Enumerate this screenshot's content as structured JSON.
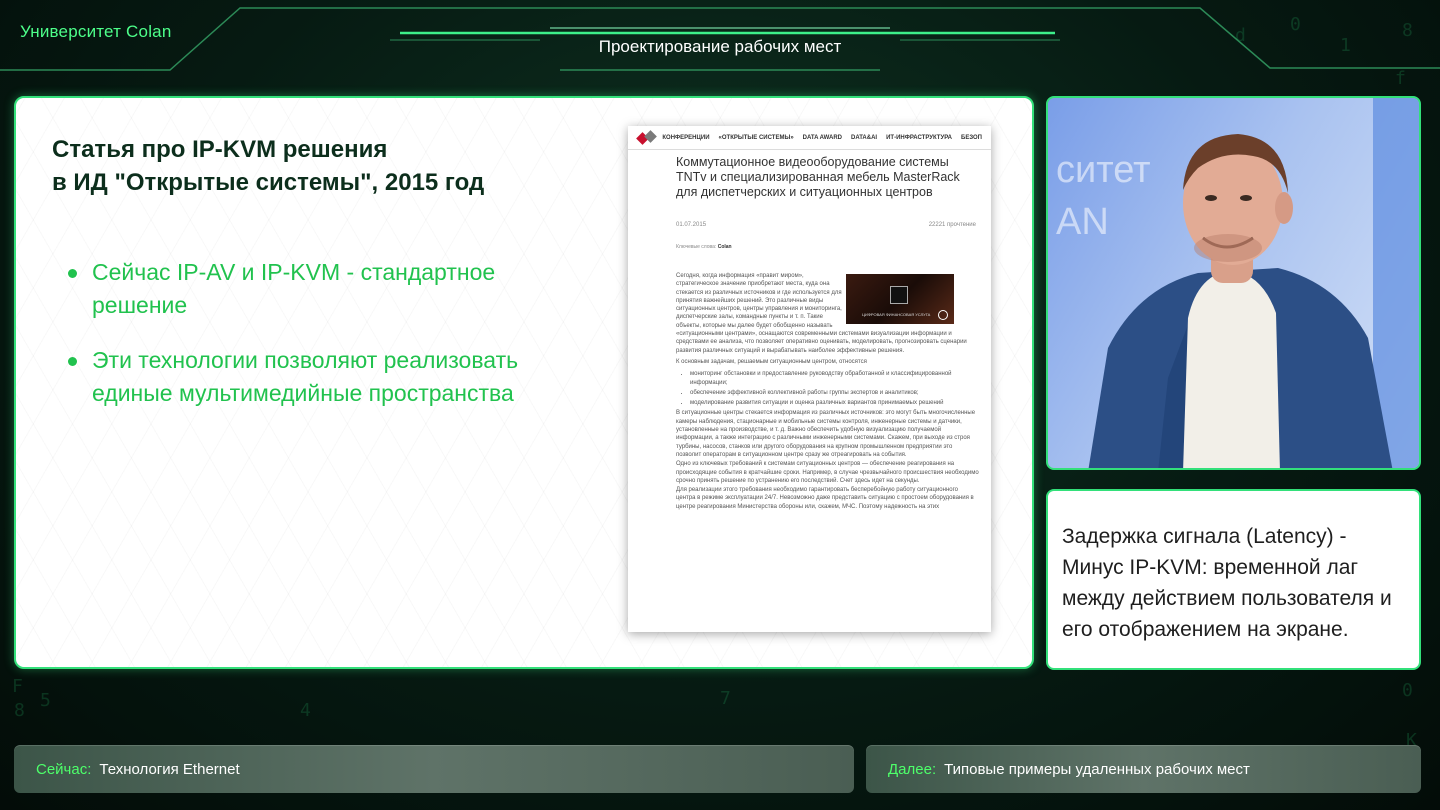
{
  "header": {
    "brand": "Университет Colan",
    "title": "Проектирование рабочих мест"
  },
  "slide": {
    "heading_line1": "Статья про IP-KVM решения",
    "heading_line2": "в ИД \"Открытые системы\", 2015 год",
    "bullets": [
      "Сейчас IP-AV и IP-KVM - стандартное решение",
      "Эти технологии позволяют реализовать единые мультимедийные пространства"
    ]
  },
  "article": {
    "nav": [
      "КОНФЕРЕНЦИИ",
      "«ОТКРЫТЫЕ СИСТЕМЫ»",
      "DATA AWARD",
      "DATA&AI",
      "ИТ-ИНФРАСТРУКТУРА",
      "БЕЗОП"
    ],
    "title": "Коммутационное видеооборудование системы TNTv и специализированная мебель MasterRack для диспетчерских и ситуационных центров",
    "date": "01.07.2015",
    "views": "22221 прочтение",
    "keywords_label": "Ключевые слова:",
    "keywords_value": "Colan",
    "video_caption": "ЦИФРОВАЯ ФИНАНСОВАЯ УСЛУГА",
    "intro": "Сегодня, когда информация «правит миром», стратегическое значение приобретают места, куда она стекается из различных источников и где используется для принятия важнейших решений. Это различные виды ситуационных центров, центры управления и мониторинга, диспетчерские залы, командные пункты и т. п. Такие объекты, которые мы далее будет обобщенно называть «ситуационными центрами», оснащаются современными системами визуализации информации и средствами ее анализа, что позволяет оперативно оценивать, моделировать, прогнозировать сценарии развития различных ситуаций и вырабатывать наиболее эффективные решения.",
    "tasks_intro": "К основным задачам, решаемым ситуационным центром, относятся",
    "tasks": [
      "мониторинг обстановки и предоставление руководству обработанной и классифицированной информации;",
      "обеспечение эффективной коллективной работы группы экспертов и аналитиков;",
      "моделирование развития ситуации и оценка различных вариантов принимаемых решений"
    ],
    "para2": "В ситуационные центры стекается информация из различных источников: это могут быть многочисленные камеры наблюдения, стационарные и мобильные системы контроля, инженерные системы и датчики, установленные на производстве, и т. д. Важно обеспечить удобную визуализацию получаемой информации, а также интеграцию с различными инженерными системами. Скажем, при выходе из строя турбины, насосов, станков или другого оборудования на крупном промышленном предприятии это позволит операторам в ситуационном центре сразу же отреагировать на события.",
    "para3": "Одно из ключевых требований к системам ситуационных центров — обеспечение реагирования на происходящие события в кратчайшие сроки. Например, в случае чрезвычайного происшествия необходимо срочно принять решение по устранению его последствий. Счет здесь идет на секунды.",
    "para4": "Для реализации этого требования необходимо гарантировать бесперебойную работу ситуационного центра в режиме эксплуатации 24/7. Невозможно даже представить ситуацию с простоем оборудования в центре реагирования Министерства обороны или, скажем, МЧС. Поэтому надежность на этих"
  },
  "speaker": {
    "backdrop_text_1": "ситет",
    "backdrop_text_2": "AN"
  },
  "caption": {
    "text": "Задержка сигнала (Latency) - Минус IP-KVM: временной лаг между действием пользователя и его отображением на экране."
  },
  "footer": {
    "now_label": "Сейчас:",
    "now_value": "Технология Ethernet",
    "next_label": "Далее:",
    "next_value": "Типовые примеры удаленных рабочих мест"
  },
  "colors": {
    "accent": "#33e07a",
    "bullet_green": "#21c24e",
    "heading_dark": "#0c2e1c",
    "footer_label": "#4dff6a"
  }
}
